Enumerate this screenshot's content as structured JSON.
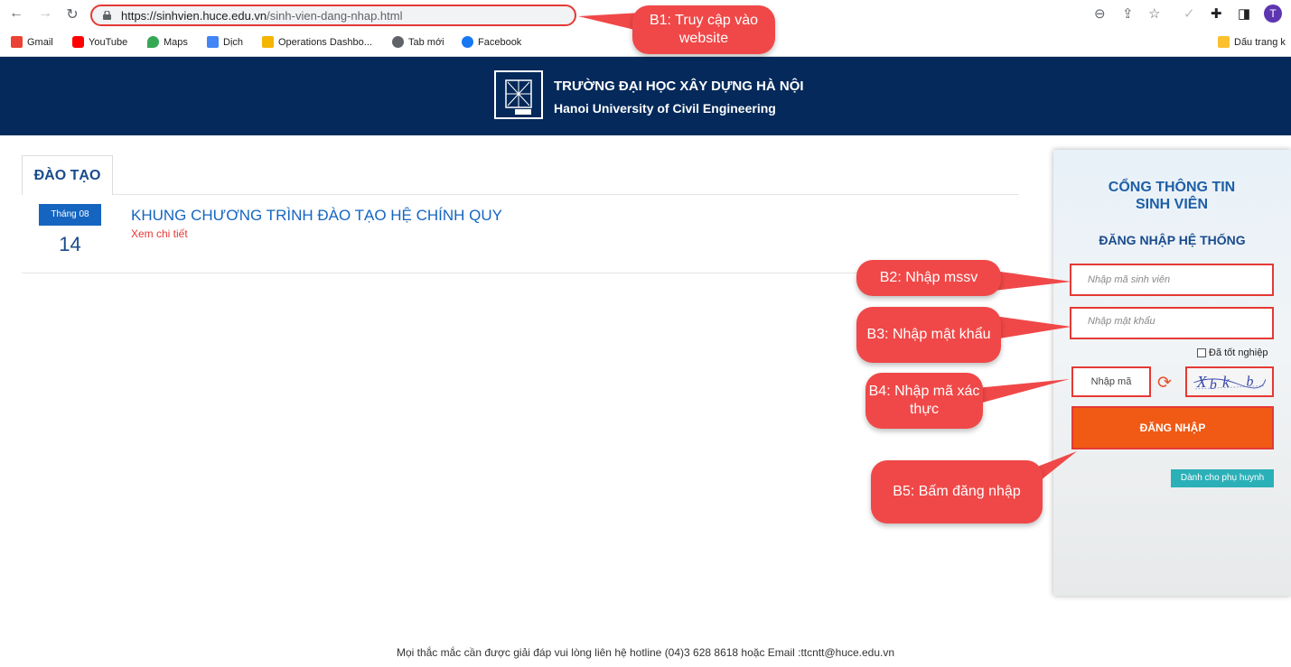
{
  "browser": {
    "url_host": "https://sinhvien.huce.edu.vn",
    "url_path": "/sinh-vien-dang-nhap.html",
    "avatar_letter": "T",
    "bookmarks": [
      "Gmail",
      "YouTube",
      "Maps",
      "Dịch",
      "Operations Dashbo...",
      "Tab mới",
      "Facebook"
    ],
    "bookmarks_folder": "Dấu trang k"
  },
  "header": {
    "name_vn": "TRƯỜNG ĐẠI HỌC XÂY DỰNG HÀ NỘI",
    "name_en": "Hanoi University of Civil Engineering"
  },
  "content": {
    "tab_label": "ĐÀO TẠO",
    "news": {
      "month": "Tháng 08",
      "day": "14",
      "title": "KHUNG CHƯƠNG TRÌNH ĐÀO TẠO HỆ CHÍNH QUY",
      "more": "Xem chi tiết"
    }
  },
  "login": {
    "title": "CỔNG THÔNG TIN SINH VIÊN",
    "subtitle": "ĐĂNG NHẬP HỆ THỐNG",
    "student_id_placeholder": "Nhập mã sinh viên",
    "password_placeholder": "Nhập mật khẩu",
    "graduated_label": "Đã tốt nghiệp",
    "captcha_placeholder": "Nhập mã",
    "login_button": "ĐĂNG NHẬP",
    "parent_button": "Dành cho phụ huynh"
  },
  "callouts": {
    "b1": "B1: Truy cập vào website",
    "b2": "B2: Nhập mssv",
    "b3": "B3: Nhập mật khẩu",
    "b4": "B4: Nhập mã xác thực",
    "b5": "B5: Bấm đăng nhập"
  },
  "footer": "Mọi thắc mắc cần được giải đáp vui lòng liên hệ hotline (04)3 628 8618 hoặc Email :ttcntt@huce.edu.vn",
  "colors": {
    "header_bg": "#04295a",
    "callout": "#f04848",
    "highlight_border": "#e53935",
    "login_button": "#f05a14",
    "parent_button": "#2bb0b8"
  },
  "icons": [
    "back-arrow-icon",
    "forward-arrow-icon",
    "reload-icon",
    "lock-icon",
    "zoom-icon",
    "share-icon",
    "star-icon",
    "check-icon",
    "extensions-icon",
    "sidepanel-icon",
    "refresh-captcha-icon",
    "checkbox-icon"
  ]
}
